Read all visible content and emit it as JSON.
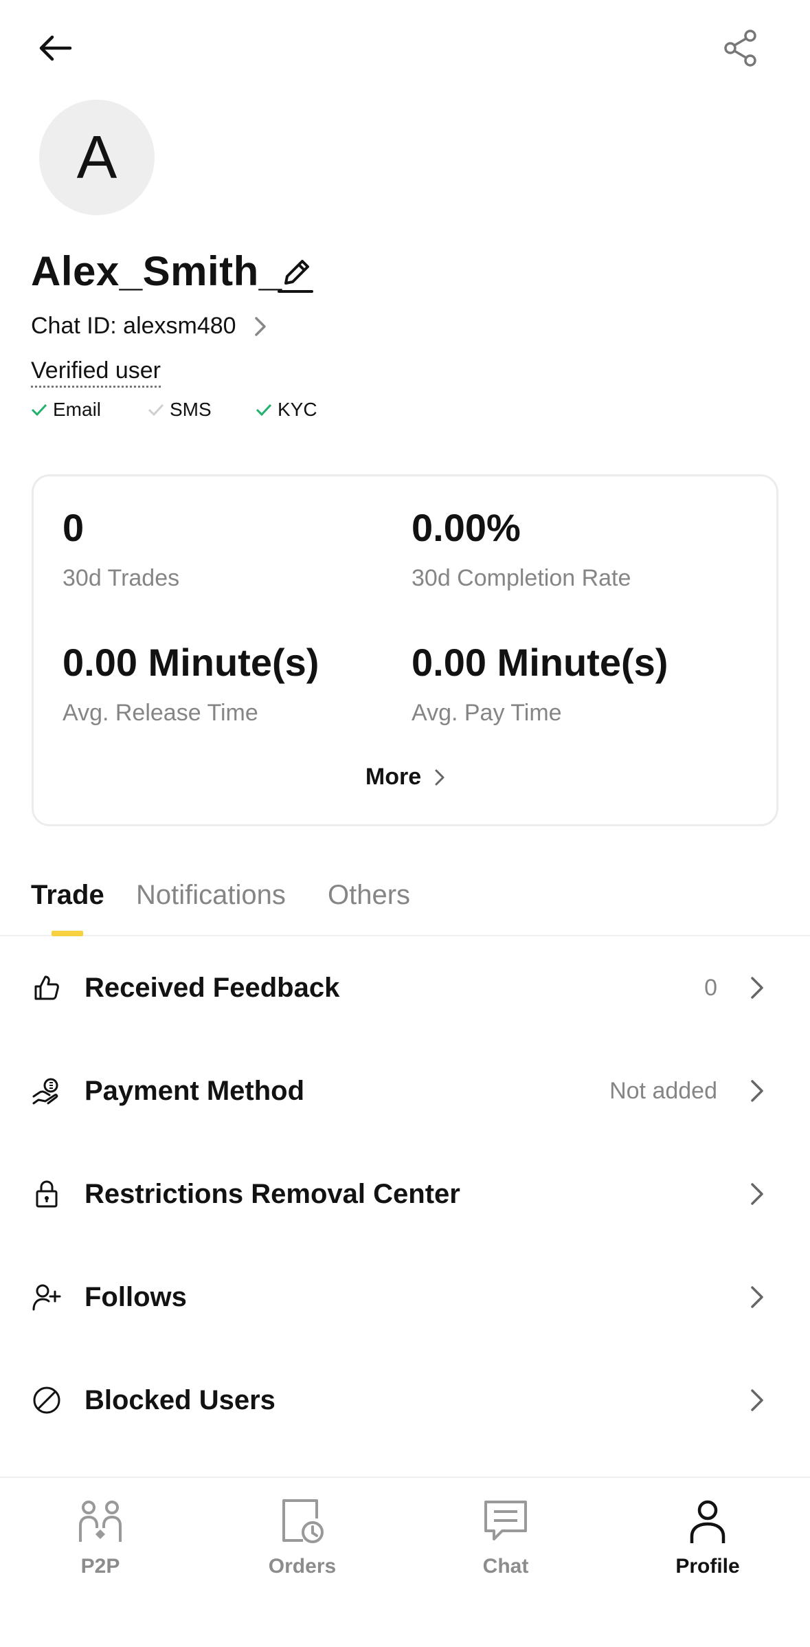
{
  "profile": {
    "avatar_letter": "A",
    "username": "Alex_Smith_",
    "chat_id": "Chat ID: alexsm480",
    "verified_label": "Verified user",
    "verifications": [
      {
        "label": "Email",
        "verified": true
      },
      {
        "label": "SMS",
        "verified": false
      },
      {
        "label": "KYC",
        "verified": true
      }
    ]
  },
  "stats": {
    "items": [
      {
        "value": "0",
        "label": "30d Trades"
      },
      {
        "value": "0.00%",
        "label": "30d Completion Rate"
      },
      {
        "value": "0.00 Minute(s)",
        "label": "Avg. Release Time"
      },
      {
        "value": "0.00 Minute(s)",
        "label": "Avg. Pay Time"
      }
    ],
    "more_label": "More"
  },
  "tabs": [
    {
      "label": "Trade",
      "active": true
    },
    {
      "label": "Notifications",
      "active": false
    },
    {
      "label": "Others",
      "active": false
    }
  ],
  "menu": [
    {
      "label": "Received Feedback",
      "value": "0",
      "icon": "thumbs-up-icon"
    },
    {
      "label": "Payment Method",
      "value": "Not added",
      "icon": "payment-hand-icon"
    },
    {
      "label": "Restrictions Removal Center",
      "value": "",
      "icon": "lock-icon"
    },
    {
      "label": "Follows",
      "value": "",
      "icon": "user-plus-icon"
    },
    {
      "label": "Blocked Users",
      "value": "",
      "icon": "blocked-icon"
    }
  ],
  "nav": [
    {
      "label": "P2P",
      "icon": "p2p-icon",
      "active": false
    },
    {
      "label": "Orders",
      "icon": "orders-icon",
      "active": false
    },
    {
      "label": "Chat",
      "icon": "chat-icon",
      "active": false
    },
    {
      "label": "Profile",
      "icon": "profile-icon",
      "active": true
    }
  ],
  "colors": {
    "accent": "#f7d23e",
    "check_green": "#20b26c",
    "check_grey": "#cfcfcf",
    "muted_text": "#858585"
  }
}
